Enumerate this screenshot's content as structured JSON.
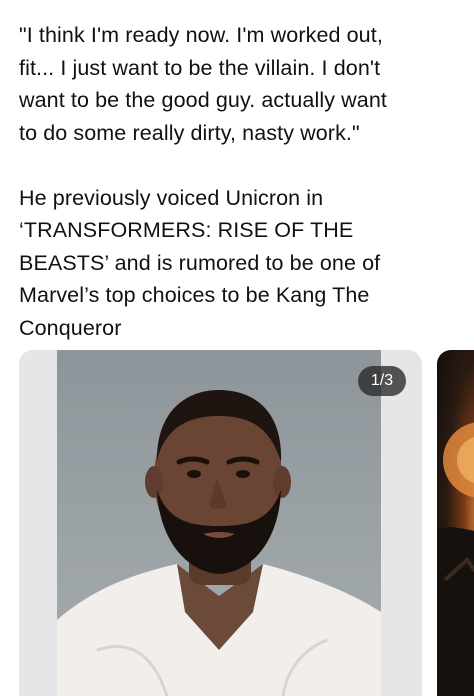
{
  "post": {
    "quote_lines": [
      "\"I think I'm ready now. I'm worked out,",
      "fit... I just want to be the villain. I don't",
      "want to be the good guy. actually want",
      "to do some really dirty, nasty work.\""
    ],
    "body_lines": [
      "He previously voiced Unicron in",
      "‘TRANSFORMERS: RISE OF THE",
      "BEASTS’ and is rumored to be one of",
      "Marvel’s top choices to be Kang The",
      "Conqueror"
    ]
  },
  "media": {
    "counter": "1/3",
    "card_background": "#e6e6e8",
    "badge_background": "#333333"
  }
}
